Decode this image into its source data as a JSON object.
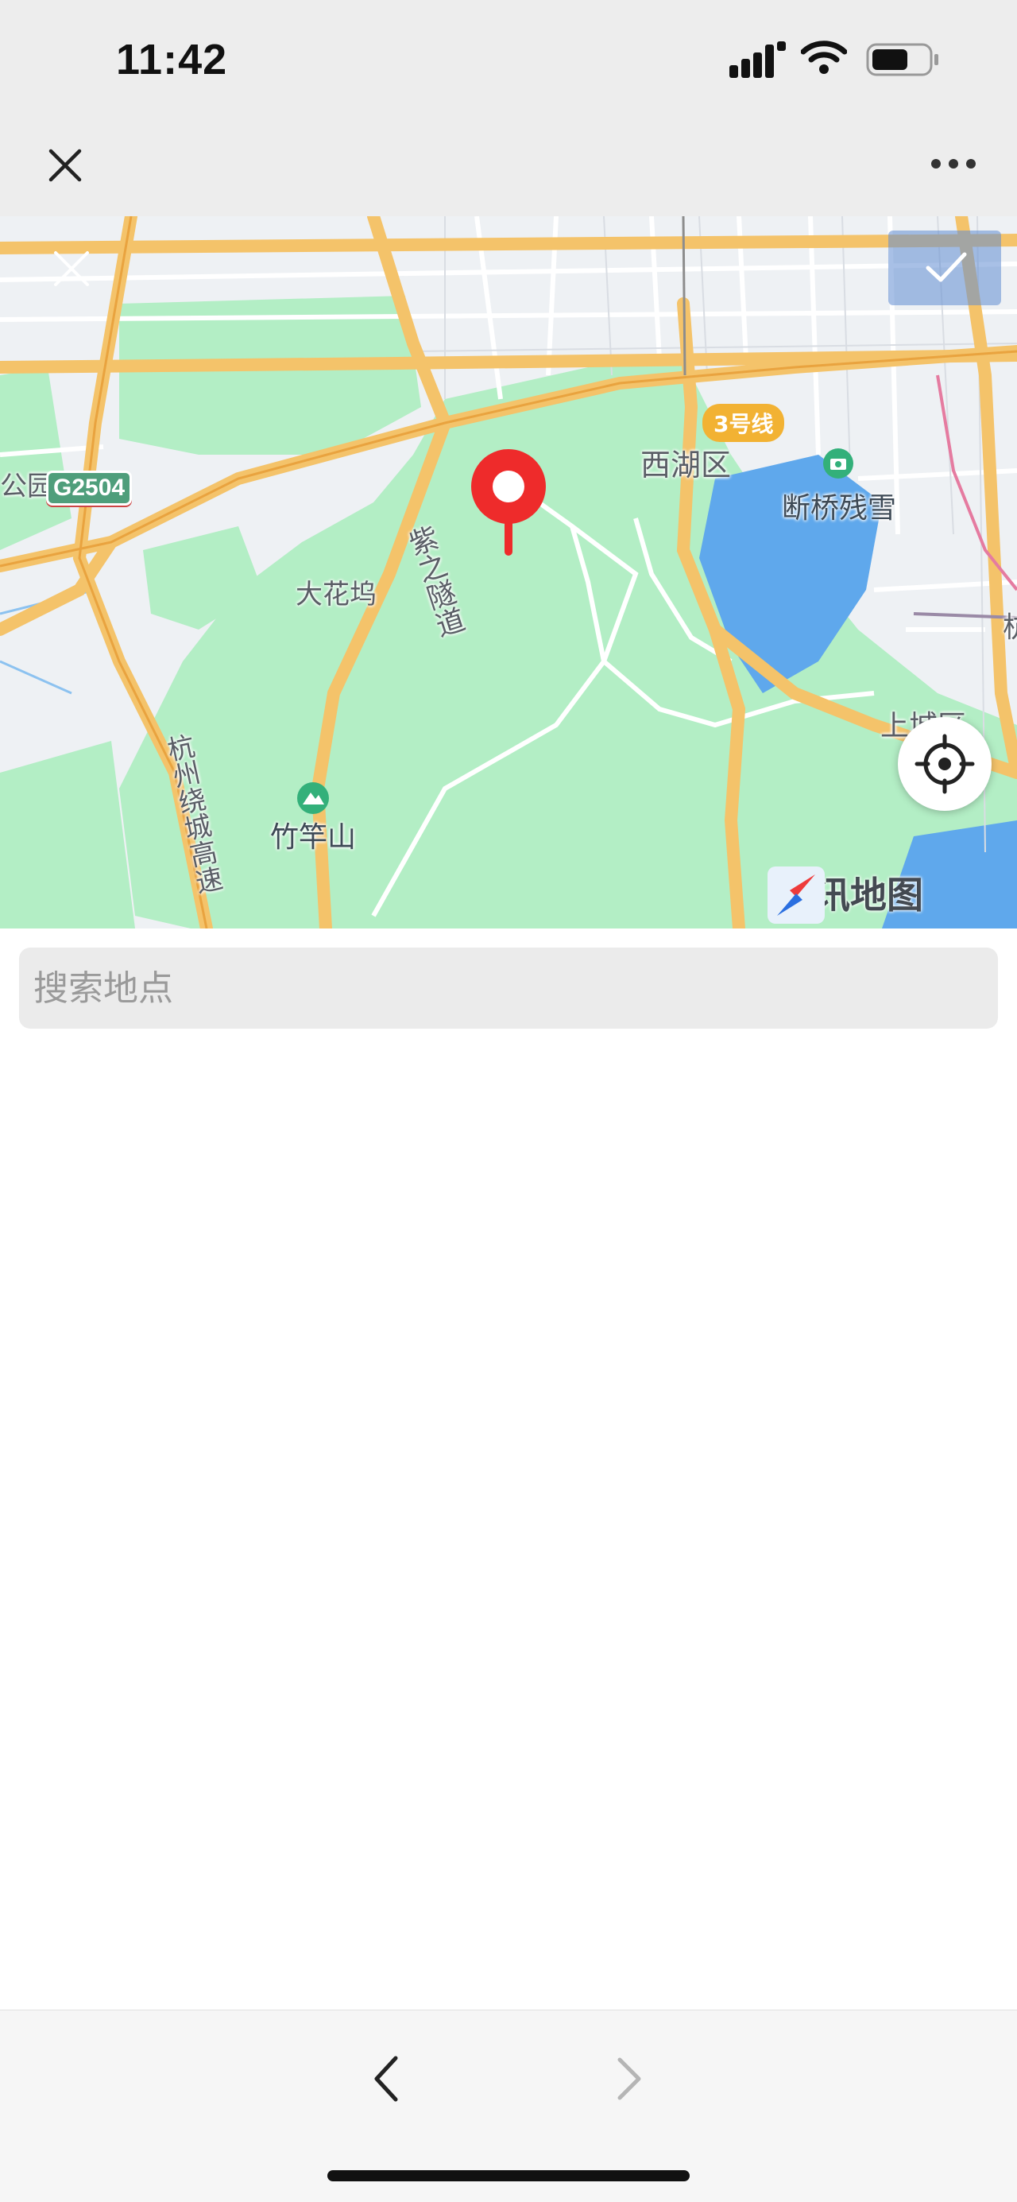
{
  "status_bar": {
    "time": "11:42"
  },
  "nav": {
    "close_icon": "close-icon",
    "more_icon": "more-icon"
  },
  "map": {
    "labels": {
      "district": "西湖区",
      "scenic": "断桥残雪",
      "village": "大花坞",
      "road": "紫之隧道",
      "mountain": "竹竿山",
      "highway": "杭州绕城高速",
      "park_fragment": "公园",
      "district_right": "上城区",
      "edge_char": "杭"
    },
    "road_badge": "G2504",
    "metro_badge": "3号线",
    "brand": "腾讯地图",
    "colors": {
      "green": "#b3eec5",
      "water": "#5fa8ec",
      "road": "#f4c36a",
      "pin": "#ee2b2b"
    }
  },
  "search": {
    "placeholder": "搜索地点"
  },
  "toolbar": {
    "back_icon": "chevron-left-icon",
    "forward_icon": "chevron-right-icon"
  }
}
